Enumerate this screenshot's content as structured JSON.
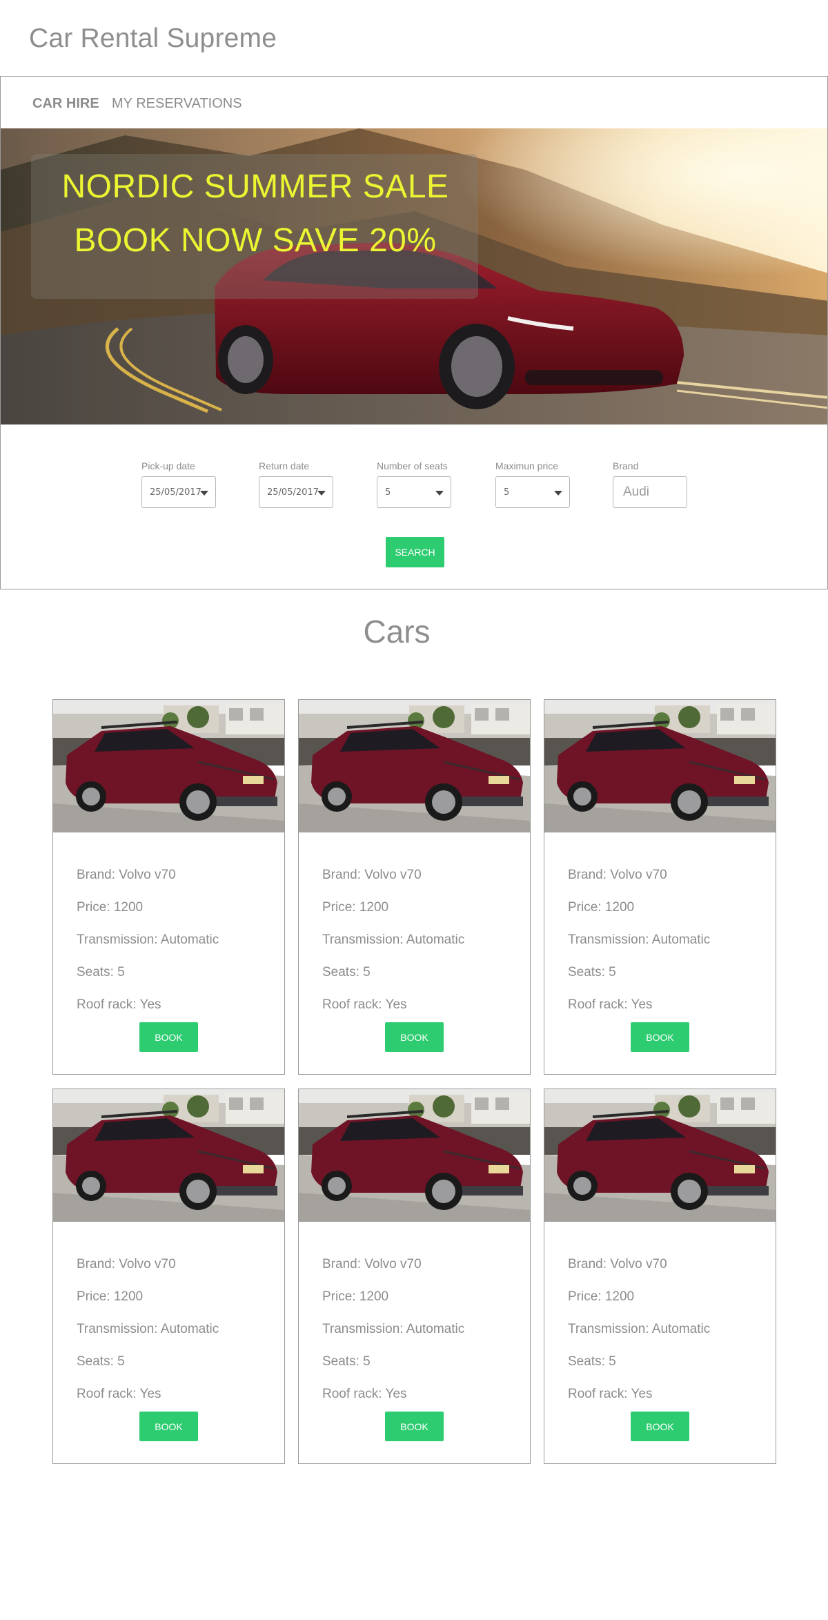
{
  "site": {
    "title": "Car Rental Supreme"
  },
  "nav": {
    "items": [
      {
        "label": "CAR HIRE",
        "active": true
      },
      {
        "label": "MY RESERVATIONS",
        "active": false
      }
    ]
  },
  "hero": {
    "line1": "NORDIC SUMMER SALE",
    "line2": "BOOK NOW SAVE 20%"
  },
  "search": {
    "pickup": {
      "label": "Pick-up date",
      "value": "25/05/2017"
    },
    "return": {
      "label": "Return date",
      "value": "25/05/2017"
    },
    "seats": {
      "label": "Number of seats",
      "value": "5"
    },
    "price": {
      "label": "Maximun price",
      "value": "5"
    },
    "brand": {
      "label": "Brand",
      "placeholder": "Audi"
    },
    "button_label": "SEARCH"
  },
  "cars_section": {
    "title": "Cars",
    "cards": [
      {
        "brand": "Brand: Volvo v70",
        "price": "Price: 1200",
        "transmission": "Transmission: Automatic",
        "seats": "Seats: 5",
        "roof_rack": "Roof rack: Yes",
        "button_label": "BOOK"
      },
      {
        "brand": "Brand: Volvo v70",
        "price": "Price: 1200",
        "transmission": "Transmission: Automatic",
        "seats": "Seats: 5",
        "roof_rack": "Roof rack: Yes",
        "button_label": "BOOK"
      },
      {
        "brand": "Brand: Volvo v70",
        "price": "Price: 1200",
        "transmission": "Transmission: Automatic",
        "seats": "Seats: 5",
        "roof_rack": "Roof rack: Yes",
        "button_label": "BOOK"
      },
      {
        "brand": "Brand: Volvo v70",
        "price": "Price: 1200",
        "transmission": "Transmission: Automatic",
        "seats": "Seats: 5",
        "roof_rack": "Roof rack: Yes",
        "button_label": "BOOK"
      },
      {
        "brand": "Brand: Volvo v70",
        "price": "Price: 1200",
        "transmission": "Transmission: Automatic",
        "seats": "Seats: 5",
        "roof_rack": "Roof rack: Yes",
        "button_label": "BOOK"
      },
      {
        "brand": "Brand: Volvo v70",
        "price": "Price: 1200",
        "transmission": "Transmission: Automatic",
        "seats": "Seats: 5",
        "roof_rack": "Roof rack: Yes",
        "button_label": "BOOK"
      }
    ]
  },
  "colors": {
    "accent_green": "#2ecc71",
    "promo_yellow": "#ecf532",
    "text_gray": "#8c8c8c",
    "car_red": "#7a0f1e"
  }
}
